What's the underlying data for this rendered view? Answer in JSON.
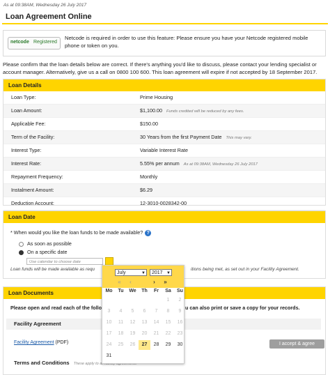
{
  "header": {
    "timestamp": "As at 09:38AM, Wednesday 26 July 2017",
    "title": "Loan Agreement Online"
  },
  "netcode": {
    "logo_text": "netcode",
    "status": "Registered",
    "message": "Netcode is required in order to use this feature: Please ensure you have your Netcode registered mobile phone or token on you."
  },
  "intro": "Please confirm that the loan details below are correct. If there's anything you'd like to discuss, please contact your lending specialist or account manager. Alternatively, give us a call on 0800 100 600. This loan agreement will expire if not accepted by 18 September 2017.",
  "loan_details": {
    "heading": "Loan Details",
    "rows": [
      {
        "label": "Loan Type:",
        "value": "Prime Housing",
        "note": ""
      },
      {
        "label": "Loan Amount:",
        "value": "$1,100.00",
        "note": "Funds credited will be reduced by any fees."
      },
      {
        "label": "Applicable Fee:",
        "value": "$150.00",
        "note": ""
      },
      {
        "label": "Term of the Facility:",
        "value": "30 Years from the first Payment Date",
        "note": "This may vary."
      },
      {
        "label": "Interest Type:",
        "value": "Variable Interest Rate",
        "note": ""
      },
      {
        "label": "Interest Rate:",
        "value": "5.55% per annum",
        "note": "As at 09:38AM, Wednesday 26 July 2017"
      },
      {
        "label": "Repayment Frequency:",
        "value": "Monthly",
        "note": ""
      },
      {
        "label": "Instalment Amount:",
        "value": "$6.29",
        "note": ""
      },
      {
        "label": "Deduction Account:",
        "value": "12-3010-0028342-00",
        "note": ""
      }
    ]
  },
  "loan_date": {
    "heading": "Loan Date",
    "question": "* When would you like the loan funds to be made available?",
    "help_icon": "?",
    "option_asap": "As soon as possible",
    "option_specific": "On a specific date",
    "selected": "specific",
    "date_placeholder": "Use calendar to choose date",
    "hint_left": "Loan funds will be made available as requ",
    "hint_right": "itions being met, as set out in your Facility Agreement."
  },
  "loan_documents": {
    "heading": "Loan Documents",
    "intro_left": "Please open and read each of the follow",
    "intro_right": "u can also print or save a copy for your records.",
    "facility_heading": "Facility Agreement",
    "facility_link": "Facility Agreement",
    "facility_link_suffix": "(PDF)",
    "accept_button": "I accept & agree",
    "terms_heading": "Terms and Conditions",
    "terms_note": "These apply to all facility agreements"
  },
  "calendar": {
    "month": "July",
    "year": "2017",
    "nav_prev_prev": "«",
    "nav_prev": "‹",
    "nav_next": "›",
    "nav_next_next": "»",
    "weekdays": [
      "Mo",
      "Tu",
      "We",
      "Th",
      "Fr",
      "Sa",
      "Su"
    ],
    "today": 27,
    "first_weekday_index": 5,
    "days_in_month": 31
  },
  "colors": {
    "accent": "#ffd400",
    "calendar_header": "#ffd84a",
    "link": "#1a5aa8",
    "button_disabled": "#9e9e9e"
  }
}
